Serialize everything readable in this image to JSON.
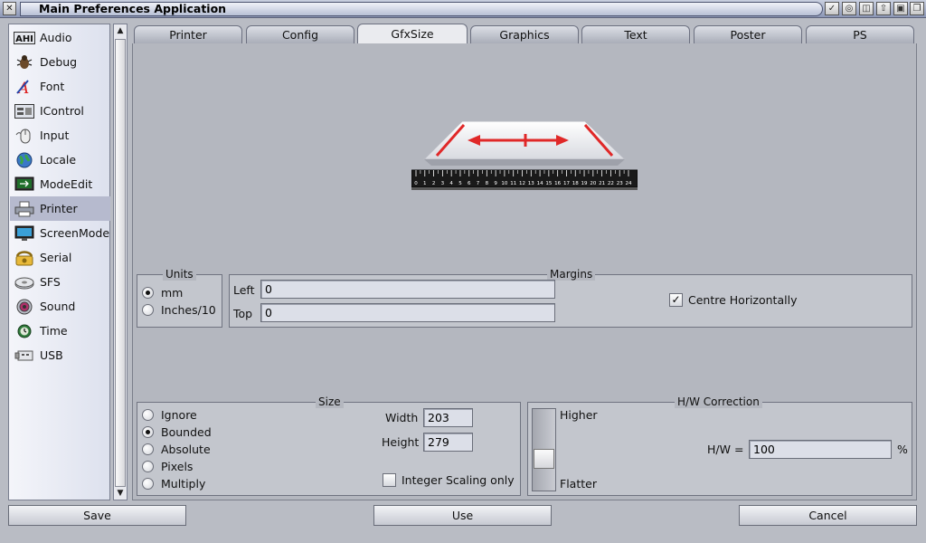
{
  "window": {
    "title": "Main Preferences Application"
  },
  "sidebar": {
    "items": [
      {
        "label": "Audio",
        "icon": "ahi-icon"
      },
      {
        "label": "Debug",
        "icon": "bug-icon"
      },
      {
        "label": "Font",
        "icon": "font-icon"
      },
      {
        "label": "IControl",
        "icon": "icontrol-icon"
      },
      {
        "label": "Input",
        "icon": "mouse-icon"
      },
      {
        "label": "Locale",
        "icon": "globe-icon"
      },
      {
        "label": "ModeEdit",
        "icon": "monitor-icon"
      },
      {
        "label": "Printer",
        "icon": "printer-icon"
      },
      {
        "label": "ScreenMode",
        "icon": "screen-icon"
      },
      {
        "label": "Serial",
        "icon": "phone-icon"
      },
      {
        "label": "SFS",
        "icon": "disk-icon"
      },
      {
        "label": "Sound",
        "icon": "speaker-icon"
      },
      {
        "label": "Time",
        "icon": "clock-icon"
      },
      {
        "label": "USB",
        "icon": "usb-icon"
      }
    ],
    "active_index": 7
  },
  "tabs": [
    "Printer",
    "Config",
    "GfxSize",
    "Graphics",
    "Text",
    "Poster",
    "PS"
  ],
  "active_tab": "GfxSize",
  "hero": {
    "ruler_labels": [
      "0",
      "1",
      "2",
      "3",
      "4",
      "5",
      "6",
      "7",
      "8",
      "9",
      "10",
      "11",
      "12",
      "13",
      "14",
      "15",
      "16",
      "17",
      "18",
      "19",
      "20",
      "21",
      "22",
      "23",
      "24"
    ]
  },
  "units": {
    "title": "Units",
    "options": [
      "mm",
      "Inches/10"
    ],
    "selected": "mm"
  },
  "margins": {
    "title": "Margins",
    "left_label": "Left",
    "left_value": "0",
    "top_label": "Top",
    "top_value": "0",
    "centre_label": "Centre Horizontally",
    "centre_checked": true
  },
  "size": {
    "title": "Size",
    "options": [
      "Ignore",
      "Bounded",
      "Absolute",
      "Pixels",
      "Multiply"
    ],
    "selected": "Bounded",
    "width_label": "Width",
    "width_value": "203",
    "height_label": "Height",
    "height_value": "279",
    "integer_label": "Integer Scaling only",
    "integer_checked": false
  },
  "hw": {
    "title": "H/W Correction",
    "higher_label": "Higher",
    "flatter_label": "Flatter",
    "ratio_label": "H/W =",
    "ratio_value": "100",
    "unit": "%",
    "slider_position": 0.5
  },
  "buttons": {
    "save": "Save",
    "use": "Use",
    "cancel": "Cancel"
  },
  "colors": {
    "accent_red": "#e02828",
    "active_item": "#b6bace"
  }
}
